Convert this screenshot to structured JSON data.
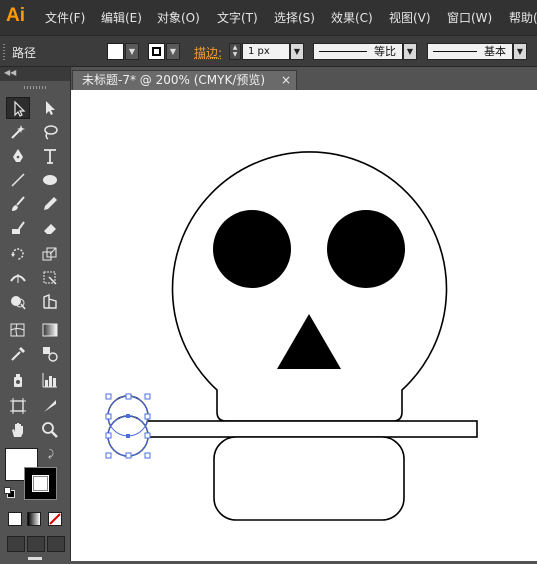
{
  "app": {
    "logo": "Ai"
  },
  "menu": [
    "文件(F)",
    "编辑(E)",
    "对象(O)",
    "文字(T)",
    "选择(S)",
    "效果(C)",
    "视图(V)",
    "窗口(W)",
    "帮助("
  ],
  "control_bar": {
    "selection_label": "路径",
    "stroke_label": "描边:",
    "stroke_weight": "1 px",
    "stroke_profile": "等比",
    "brush": "基本"
  },
  "document": {
    "tab_title": "未标题-7* @ 200% (CMYK/预览)",
    "close_glyph": "×"
  },
  "colors": {
    "fill": "#ffffff",
    "stroke": "#000000",
    "selection": "#4a6fe0",
    "accent": "#ff9a00"
  },
  "tools": [
    "selection-tool",
    "direct-selection-tool",
    "magic-wand-tool",
    "lasso-tool",
    "pen-tool",
    "type-tool",
    "line-segment-tool",
    "ellipse-tool",
    "paintbrush-tool",
    "pencil-tool",
    "blob-brush-tool",
    "eraser-tool",
    "rotate-tool",
    "scale-tool",
    "width-tool",
    "free-transform-tool",
    "shape-builder-tool",
    "perspective-grid-tool",
    "mesh-tool",
    "gradient-tool",
    "eyedropper-tool",
    "blend-tool",
    "symbol-sprayer-tool",
    "column-graph-tool",
    "artboard-tool",
    "slice-tool",
    "hand-tool",
    "zoom-tool"
  ]
}
